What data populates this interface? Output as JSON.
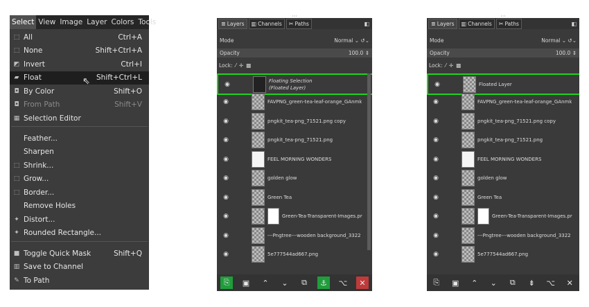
{
  "menu": {
    "menubar": [
      "Select",
      "View",
      "Image",
      "Layer",
      "Colors",
      "Tools"
    ],
    "items": [
      {
        "label": "All",
        "shortcut": "Ctrl+A",
        "icon": "select-all-icon",
        "glyph": "⬚"
      },
      {
        "label": "None",
        "shortcut": "Shift+Ctrl+A",
        "icon": "select-none-icon",
        "glyph": "⬚"
      },
      {
        "label": "Invert",
        "shortcut": "Ctrl+I",
        "icon": "invert-icon",
        "glyph": "◩"
      },
      {
        "label": "Float",
        "shortcut": "Shift+Ctrl+L",
        "icon": "float-icon",
        "glyph": "▰"
      },
      {
        "label": "By Color",
        "shortcut": "Shift+O",
        "icon": "by-color-icon",
        "glyph": "◘"
      },
      {
        "label": "From Path",
        "shortcut": "Shift+V",
        "icon": "from-path-icon",
        "glyph": "◘"
      },
      {
        "label": "Selection Editor",
        "shortcut": "",
        "icon": "selection-editor-icon",
        "glyph": "▦"
      },
      {
        "label": "Feather...",
        "shortcut": "",
        "icon": "",
        "glyph": ""
      },
      {
        "label": "Sharpen",
        "shortcut": "",
        "icon": "",
        "glyph": ""
      },
      {
        "label": "Shrink...",
        "shortcut": "",
        "icon": "shrink-icon",
        "glyph": "⬚"
      },
      {
        "label": "Grow...",
        "shortcut": "",
        "icon": "grow-icon",
        "glyph": "⬚"
      },
      {
        "label": "Border...",
        "shortcut": "",
        "icon": "border-icon",
        "glyph": "⬚"
      },
      {
        "label": "Remove Holes",
        "shortcut": "",
        "icon": "",
        "glyph": ""
      },
      {
        "label": "Distort...",
        "shortcut": "",
        "icon": "distort-icon",
        "glyph": "✦"
      },
      {
        "label": "Rounded Rectangle...",
        "shortcut": "",
        "icon": "rounded-rectangle-icon",
        "glyph": "✦"
      },
      {
        "label": "Toggle Quick Mask",
        "shortcut": "Shift+Q",
        "icon": "quick-mask-icon",
        "glyph": "■"
      },
      {
        "label": "Save to Channel",
        "shortcut": "",
        "icon": "save-channel-icon",
        "glyph": "▥"
      },
      {
        "label": "To Path",
        "shortcut": "",
        "icon": "to-path-icon",
        "glyph": "✎"
      }
    ]
  },
  "panel": {
    "tabs": [
      "Layers",
      "Channels",
      "Paths"
    ],
    "mode_label": "Mode",
    "mode_value": "Normal",
    "opacity_label": "Opacity",
    "opacity_value": "100.0",
    "lock_label": "Lock:"
  },
  "left_panel_layers": [
    {
      "line1": "Floating Selection",
      "line2": "(Floated Layer)",
      "thumb": "dark"
    },
    {
      "line1": "FAVPNG_green-tea-leaf-orange_GAnmk",
      "thumb": "check"
    },
    {
      "line1": "pngkit_tea-png_71521.png copy",
      "thumb": "check"
    },
    {
      "line1": "pngkit_tea-png_71521.png",
      "thumb": "check"
    },
    {
      "line1": "FEEL MORNING WONDERS",
      "thumb": "text"
    },
    {
      "line1": "golden glow",
      "thumb": "check"
    },
    {
      "line1": "Green Tea",
      "thumb": "check"
    },
    {
      "line1": "Green-Tea-Transparent-Images.pr",
      "thumb": "mask"
    },
    {
      "line1": "---Pngtree---wooden background_3322",
      "thumb": "check"
    },
    {
      "line1": "5e777544ad667.png",
      "thumb": "check"
    }
  ],
  "right_panel_layers": [
    {
      "line1": "Floated Layer",
      "thumb": "check"
    },
    {
      "line1": "FAVPNG_green-tea-leaf-orange_GAnmk",
      "thumb": "check"
    },
    {
      "line1": "pngkit_tea-png_71521.png copy",
      "thumb": "check"
    },
    {
      "line1": "pngkit_tea-png_71521.png",
      "thumb": "check"
    },
    {
      "line1": "FEEL MORNING WONDERS",
      "thumb": "text"
    },
    {
      "line1": "golden glow",
      "thumb": "check"
    },
    {
      "line1": "Green Tea",
      "thumb": "check"
    },
    {
      "line1": "Green-Tea-Transparent-Images.pr",
      "thumb": "mask"
    },
    {
      "line1": "---Pngtree---wooden background_3322",
      "thumb": "check"
    },
    {
      "line1": "5e777544ad667.png",
      "thumb": "check"
    }
  ],
  "highlight_color": "#21d11f",
  "bottom_left": [
    "new-layer-icon",
    "new-group-icon",
    "raise-icon",
    "lower-icon",
    "duplicate-icon",
    "anchor-icon",
    "mask-icon",
    "delete-icon"
  ],
  "bottom_right": [
    "new-layer-icon",
    "new-group-icon",
    "raise-icon",
    "lower-icon",
    "duplicate-icon",
    "merge-icon",
    "mask-icon",
    "delete-icon"
  ]
}
